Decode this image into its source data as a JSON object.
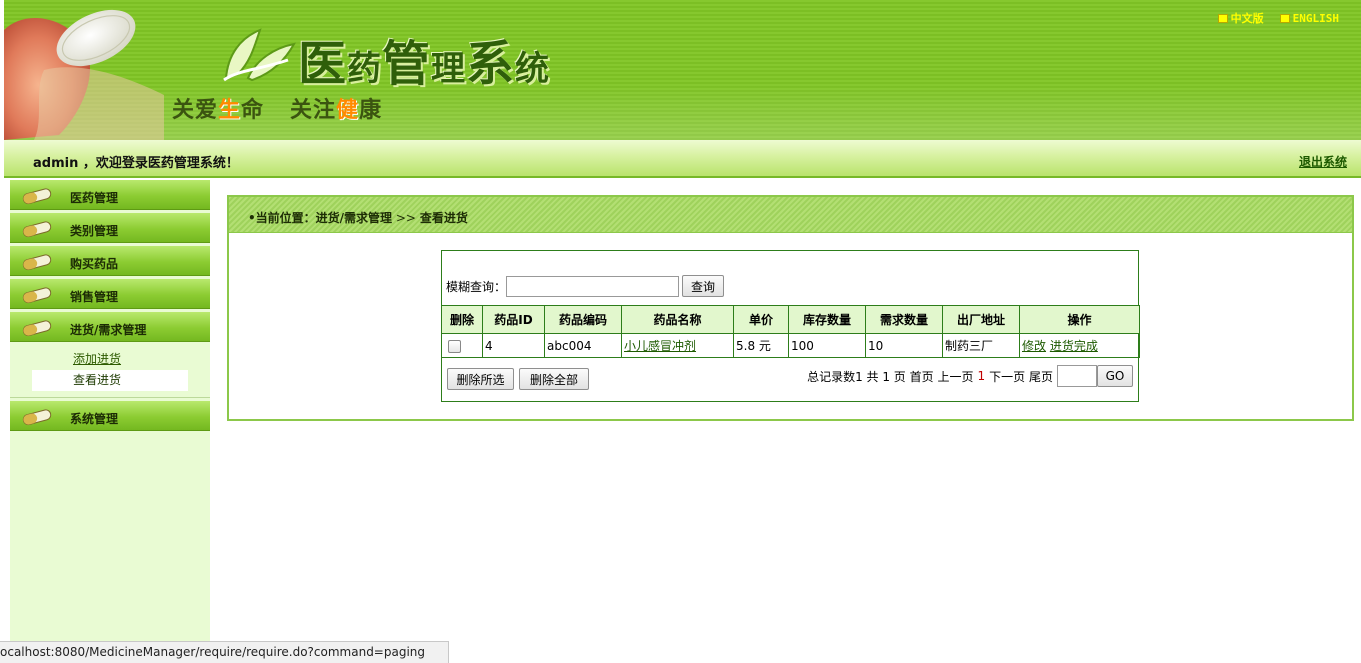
{
  "header": {
    "title_parts": [
      "医",
      "药",
      "管",
      "理",
      "系",
      "统"
    ],
    "slogan": {
      "p1": "关爱",
      "h1": "生",
      "p2": "命",
      "p3": "关注",
      "h2": "健",
      "p4": "康"
    },
    "lang_links": [
      {
        "label": "中文版"
      },
      {
        "label": "ENGLISH"
      }
    ],
    "colors": {
      "banner": "#86c82e",
      "title": "#2f5f0a",
      "highlight": "#ff8a00",
      "lang": "#ffff00"
    }
  },
  "welcome": {
    "text": "admin ，欢迎登录医药管理系统！",
    "logout_label": "退出系统"
  },
  "sidebar": {
    "menus": [
      {
        "label": "医药管理",
        "icon": "pill-capsule-icon"
      },
      {
        "label": "类别管理",
        "icon": "pill-capsule-icon"
      },
      {
        "label": "购买药品",
        "icon": "pill-capsule-icon"
      },
      {
        "label": "销售管理",
        "icon": "pill-capsule-icon"
      },
      {
        "label": "进货/需求管理",
        "icon": "pill-capsule-icon",
        "sub_items": [
          {
            "label": "添加进货",
            "active": false
          },
          {
            "label": "查看进货",
            "active": true
          }
        ]
      },
      {
        "label": "系统管理",
        "icon": "pill-capsule-icon"
      }
    ]
  },
  "breadcrumb": {
    "prefix": "•当前位置：",
    "section": "进货/需求管理",
    "separator": " >> ",
    "current": "查看进货"
  },
  "search": {
    "label": "模糊查询：",
    "value": "",
    "placeholder": "",
    "button_label": "查询"
  },
  "table": {
    "columns": [
      "删除",
      "药品ID",
      "药品编码",
      "药品名称",
      "单价",
      "库存数量",
      "需求数量",
      "出厂地址",
      "操作"
    ],
    "rows": [
      {
        "id": "4",
        "code": "abc004",
        "name": "小儿感冒冲剂",
        "price": "5.8 元",
        "stock": "100",
        "demand": "10",
        "factory": "制药三厂",
        "actions": [
          "修改",
          "进货完成"
        ]
      }
    ]
  },
  "bulk_actions": {
    "delete_selected": "删除所选",
    "delete_all": "删除全部"
  },
  "pager": {
    "total_text": "总记录数1",
    "pages_text": "共 1 页",
    "first": "首页",
    "prev": "上一页",
    "current": "1",
    "next": "下一页",
    "last": "尾页",
    "go_label": "GO",
    "page_input_value": ""
  },
  "status_bar": {
    "url": "ocalhost:8080/MedicineManager/require/require.do?command=paging"
  }
}
